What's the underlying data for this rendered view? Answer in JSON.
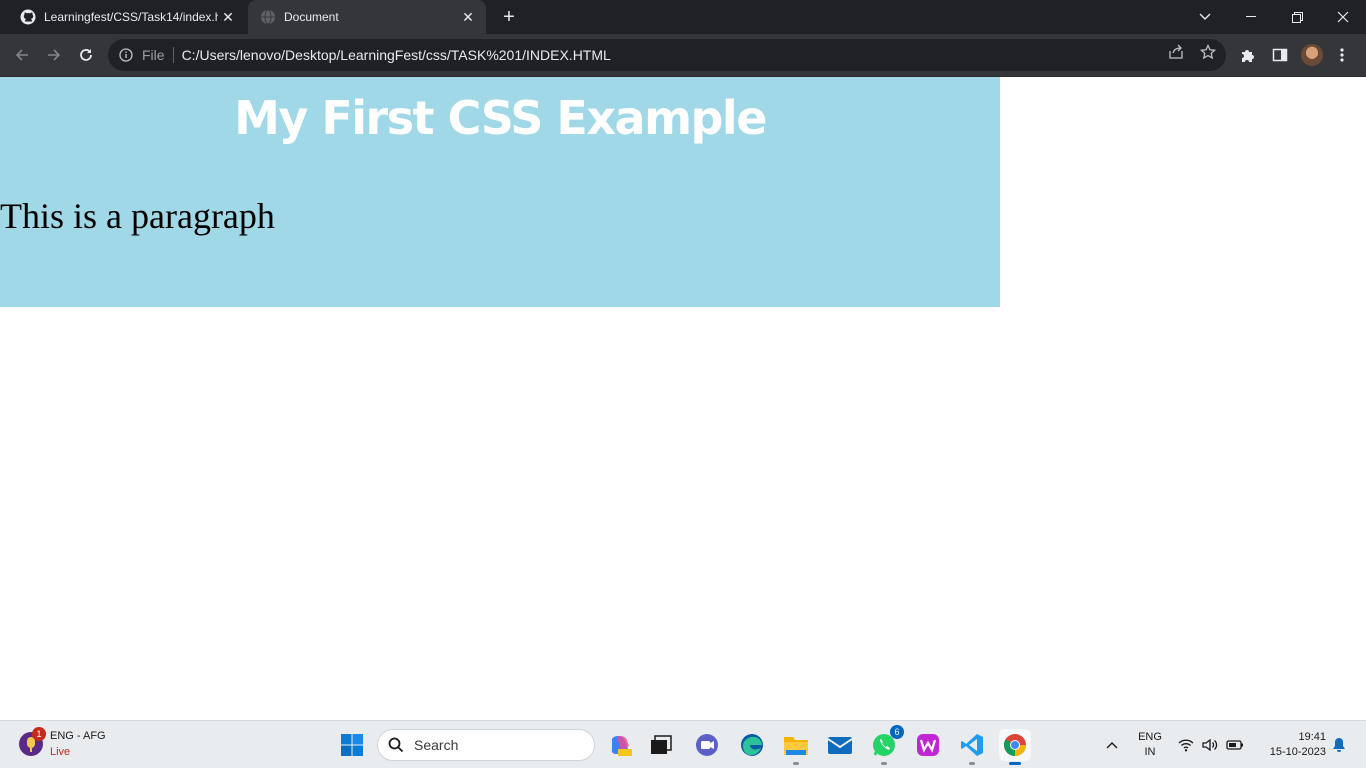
{
  "browser": {
    "tabs": [
      {
        "title": "Learningfest/CSS/Task14/index.h",
        "active": false,
        "icon": "github-icon"
      },
      {
        "title": "Document",
        "active": true,
        "icon": "globe-icon"
      }
    ],
    "address": {
      "scheme_label": "File",
      "url": "C:/Users/lenovo/Desktop/LearningFest/css/TASK%201/INDEX.HTML"
    }
  },
  "page": {
    "heading": "My First CSS Example",
    "paragraph": "This is a paragraph",
    "panel_color": "#a0d8e7"
  },
  "taskbar": {
    "widget": {
      "title": "ENG - AFG",
      "status": "Live",
      "badge": "1"
    },
    "search_label": "Search",
    "badges": {
      "whatsapp": "6"
    },
    "tray": {
      "lang_top": "ENG",
      "lang_bottom": "IN",
      "time": "19:41",
      "date": "15-10-2023"
    }
  }
}
